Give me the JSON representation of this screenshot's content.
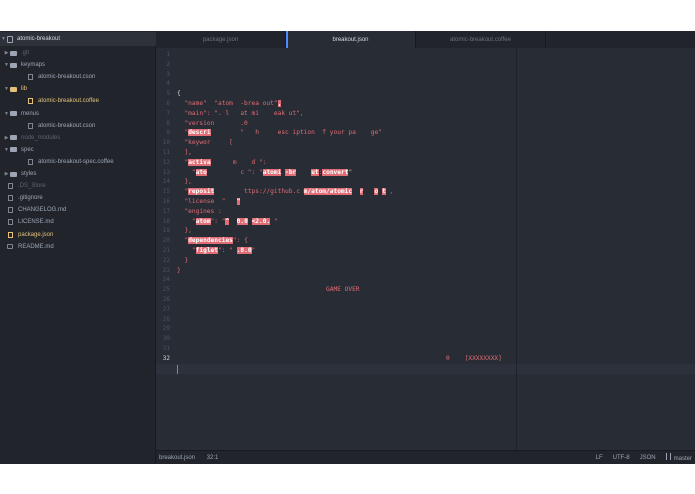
{
  "tree": {
    "project": "atomic-breakout",
    "items": [
      {
        "label": ".git",
        "kind": "folder",
        "depth": 1,
        "expanded": false,
        "state": "dim"
      },
      {
        "label": "keymaps",
        "kind": "folder",
        "depth": 1,
        "expanded": true,
        "state": ""
      },
      {
        "label": "atomic-breakout.cson",
        "kind": "file",
        "depth": 2,
        "state": ""
      },
      {
        "label": "lib",
        "kind": "folder",
        "depth": 1,
        "expanded": true,
        "state": "active"
      },
      {
        "label": "atomic-breakout.coffee",
        "kind": "file",
        "depth": 2,
        "state": "active"
      },
      {
        "label": "menus",
        "kind": "folder",
        "depth": 1,
        "expanded": true,
        "state": ""
      },
      {
        "label": "atomic-breakout.cson",
        "kind": "file",
        "depth": 2,
        "state": ""
      },
      {
        "label": "node_modules",
        "kind": "folder",
        "depth": 1,
        "expanded": false,
        "state": "dim"
      },
      {
        "label": "spec",
        "kind": "folder",
        "depth": 1,
        "expanded": true,
        "state": ""
      },
      {
        "label": "atomic-breakout-spec.coffee",
        "kind": "file",
        "depth": 2,
        "state": ""
      },
      {
        "label": "styles",
        "kind": "folder",
        "depth": 1,
        "expanded": false,
        "state": ""
      },
      {
        "label": ".DS_Store",
        "kind": "file",
        "depth": 1,
        "state": "dim"
      },
      {
        "label": ".gitignore",
        "kind": "file",
        "depth": 1,
        "state": ""
      },
      {
        "label": "CHANGELOG.md",
        "kind": "file",
        "depth": 1,
        "state": ""
      },
      {
        "label": "LICENSE.md",
        "kind": "file",
        "depth": 1,
        "state": ""
      },
      {
        "label": "package.json",
        "kind": "file",
        "depth": 1,
        "state": "selected-file"
      },
      {
        "label": "README.md",
        "kind": "book",
        "depth": 1,
        "state": ""
      }
    ]
  },
  "tabs": [
    {
      "label": "package.json",
      "active": false
    },
    {
      "label": "breakout.json",
      "active": true
    },
    {
      "label": "atomic-breakout.coffee",
      "active": false
    }
  ],
  "editor": {
    "line_numbers": [
      "1",
      "2",
      "3",
      "4",
      "5",
      "6",
      "7",
      "8",
      "9",
      "10",
      "11",
      "12",
      "13",
      "14",
      "15",
      "16",
      "17",
      "18",
      "19",
      "20",
      "21",
      "22",
      "23",
      "24",
      "25",
      "26",
      "27",
      "28",
      "29",
      "30",
      "31",
      "32"
    ],
    "current_line": "32",
    "lines": [
      {
        "n": 5,
        "parts": [
          [
            "w",
            "{"
          ]
        ]
      },
      {
        "n": 6,
        "parts": [
          [
            "r",
            "  \"name\"  \"atom  -brea out\""
          ],
          [
            "hl",
            ","
          ]
        ]
      },
      {
        "n": 7,
        "parts": [
          [
            "r",
            "  \"main\": \". l   at mi    eak ut\","
          ]
        ]
      },
      {
        "n": 8,
        "parts": [
          [
            "r",
            "  \"version       .0"
          ]
        ]
      },
      {
        "n": 9,
        "parts": [
          [
            "r",
            "  \""
          ],
          [
            "hl",
            "descri"
          ],
          [
            "r",
            "        \"   h     esc iption  f your pa    ge\""
          ]
        ]
      },
      {
        "n": 10,
        "parts": [
          [
            "r",
            "  \"keywor     ["
          ]
        ]
      },
      {
        "n": 11,
        "parts": [
          [
            "r",
            "  ],"
          ]
        ]
      },
      {
        "n": 12,
        "parts": [
          [
            "r",
            "  \""
          ],
          [
            "hl",
            "activa"
          ],
          [
            "r",
            "      m    d \":"
          ]
        ]
      },
      {
        "n": 13,
        "parts": [
          [
            "r",
            "    \""
          ],
          [
            "hl",
            "ato"
          ],
          [
            "r",
            "         c \": \""
          ],
          [
            "hl",
            "atomi"
          ],
          [
            "r",
            " "
          ],
          [
            "hl",
            "-br"
          ],
          [
            "r",
            "    "
          ],
          [
            "hl",
            "ut"
          ],
          [
            "r",
            ":"
          ],
          [
            "hl",
            "convert"
          ],
          [
            "y",
            "\""
          ]
        ]
      },
      {
        "n": 14,
        "parts": [
          [
            "r",
            "  },"
          ]
        ]
      },
      {
        "n": 15,
        "parts": [
          [
            "r",
            "  \""
          ],
          [
            "hl",
            "reposit"
          ],
          [
            "r",
            "        ttps://github.c "
          ],
          [
            "hl",
            "m/atom/atomic"
          ],
          [
            "r",
            "  "
          ],
          [
            "hl",
            "r"
          ],
          [
            "r",
            "   "
          ],
          [
            "hl",
            "o"
          ],
          [
            "r",
            " "
          ],
          [
            "hl",
            "t"
          ],
          [
            "r",
            " ,"
          ]
        ]
      },
      {
        "n": 16,
        "parts": [
          [
            "r",
            "  \"license  \"   "
          ],
          [
            "hl",
            "\""
          ]
        ]
      },
      {
        "n": 17,
        "parts": [
          [
            "r",
            "  \"engines :"
          ]
        ]
      },
      {
        "n": 18,
        "parts": [
          [
            "r",
            "    \""
          ],
          [
            "hl",
            "atom"
          ],
          [
            "r",
            "\": \""
          ],
          [
            "hl",
            "^"
          ],
          [
            "r",
            "  "
          ],
          [
            "hl",
            "0.0"
          ],
          [
            "r",
            " "
          ],
          [
            "hl",
            "<2.0."
          ],
          [
            "r",
            " \""
          ]
        ]
      },
      {
        "n": 19,
        "parts": [
          [
            "r",
            "  },"
          ]
        ]
      },
      {
        "n": 20,
        "parts": [
          [
            "r",
            "  \""
          ],
          [
            "hl",
            "dependencies"
          ],
          [
            "r",
            "\": {"
          ]
        ]
      },
      {
        "n": 21,
        "parts": [
          [
            "r",
            "    \""
          ],
          [
            "hl",
            "figlet"
          ],
          [
            "r",
            "\": \" "
          ],
          [
            "hl",
            ".8.0"
          ],
          [
            "r",
            "\""
          ]
        ]
      },
      {
        "n": 22,
        "parts": [
          [
            "r",
            "  }"
          ]
        ]
      },
      {
        "n": 23,
        "parts": [
          [
            "r",
            "}"
          ]
        ]
      }
    ],
    "game_over": "GAME OVER",
    "score": "0    [XXXXXXXX]"
  },
  "status": {
    "file": "breakout.json",
    "position": "32:1",
    "line_ending": "LF",
    "encoding": "UTF-8",
    "grammar": "JSON",
    "branch": "master"
  },
  "colors": {
    "bg": "#282c34",
    "panel": "#21252b",
    "accent": "#528bff",
    "brick": "#e06c75"
  }
}
